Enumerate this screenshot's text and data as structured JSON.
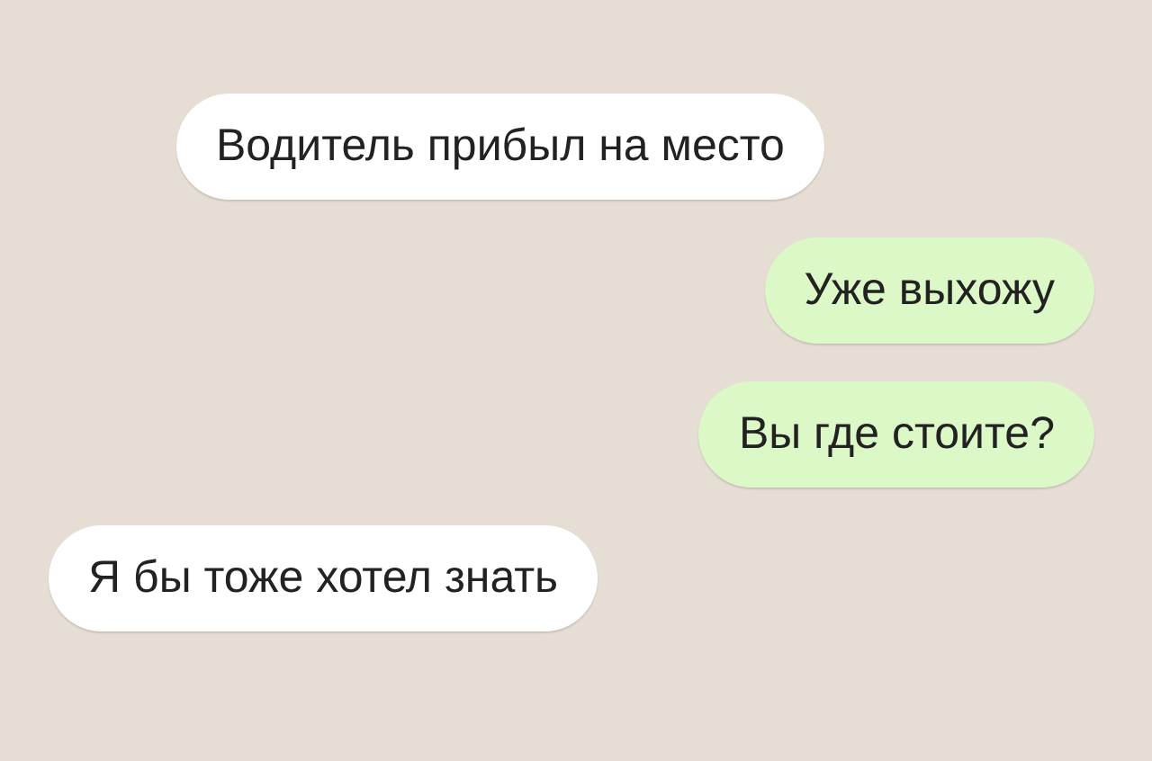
{
  "messages": [
    {
      "kind": "incoming",
      "text": "Водитель прибыл на место"
    },
    {
      "kind": "outgoing",
      "text": "Уже выхожу"
    },
    {
      "kind": "outgoing",
      "text": "Вы где стоите?"
    },
    {
      "kind": "incoming",
      "text": "Я бы тоже хотел знать"
    }
  ]
}
